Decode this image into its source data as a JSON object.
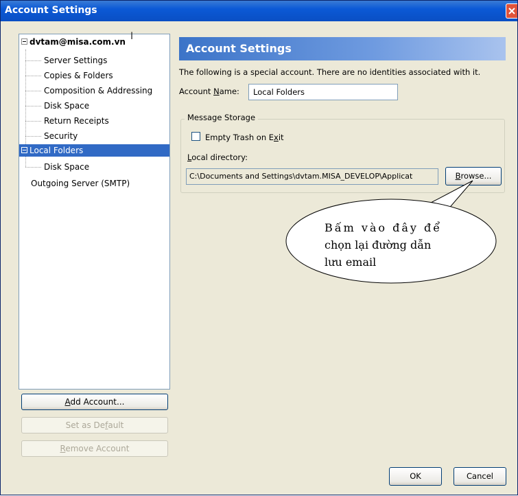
{
  "window": {
    "title": "Account Settings"
  },
  "tree": {
    "account": "dvtam@misa.com.vn",
    "account_children": [
      "Server Settings",
      "Copies & Folders",
      "Composition & Addressing",
      "Disk Space",
      "Return Receipts",
      "Security"
    ],
    "local_folders": "Local Folders",
    "local_children": [
      "Disk Space"
    ],
    "outgoing": "Outgoing Server (SMTP)"
  },
  "left_buttons": {
    "add_account": {
      "pre": "",
      "u": "A",
      "post": "dd Account..."
    },
    "set_default": {
      "pre": "Set as De",
      "u": "f",
      "post": "ault"
    },
    "remove_account": {
      "pre": "",
      "u": "R",
      "post": "emove Account"
    }
  },
  "main": {
    "header": "Account Settings",
    "info": "The following is a special account. There are no identities associated with it.",
    "account_name_label": {
      "pre": "Account ",
      "u": "N",
      "post": "ame:"
    },
    "account_name_value": "Local Folders",
    "storage_legend": "Message Storage",
    "empty_trash": {
      "pre": "Empty Trash on E",
      "u": "x",
      "post": "it",
      "checked": false
    },
    "local_dir_label": {
      "pre": "",
      "u": "L",
      "post": "ocal directory:"
    },
    "local_dir_value": "C:\\Documents and Settings\\dvtam.MISA_DEVELOP\\Applicat",
    "browse": {
      "pre": "",
      "u": "B",
      "post": "rowse..."
    }
  },
  "callout": {
    "lines": [
      "Bấm vào đây để",
      "chọn lại đường dẫn",
      "lưu email"
    ]
  },
  "footer": {
    "ok": "OK",
    "cancel": "Cancel"
  },
  "colors": {
    "titlebar": "#0b59d6",
    "selection": "#316ac5",
    "header_banner": "#3c74c8",
    "dialog_bg": "#ece9d8"
  }
}
